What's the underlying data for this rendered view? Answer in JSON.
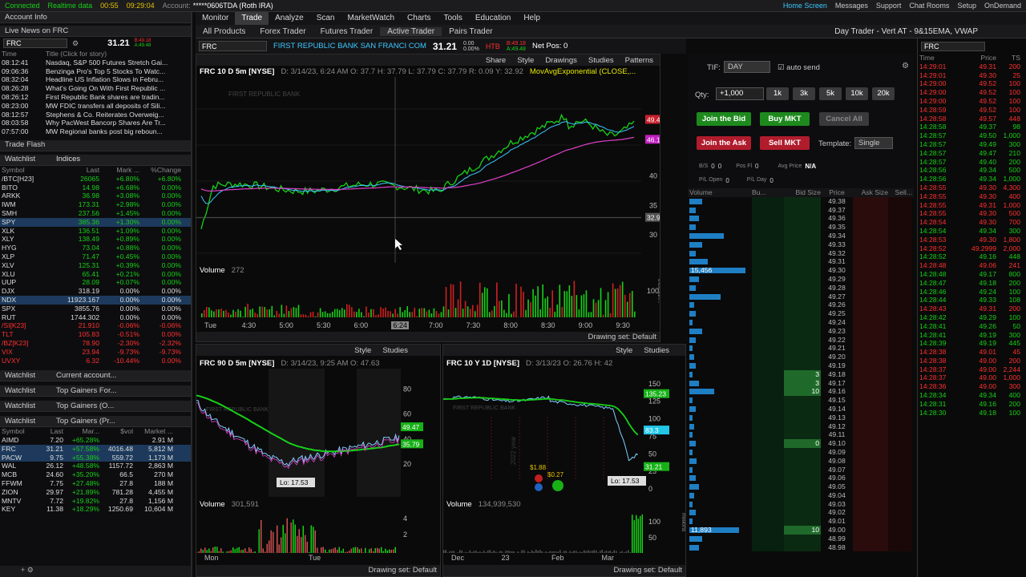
{
  "topbar": {
    "connected": "Connected",
    "realtime": "Realtime data",
    "timer": "00:55",
    "clock": "09:29:04",
    "account_label": "Account:",
    "account": "*****0606TDA (Roth IRA)",
    "home": "Home Screen",
    "messages": "Messages",
    "support": "Support",
    "chat": "Chat Rooms",
    "setup": "Setup",
    "ondemand": "OnDemand"
  },
  "nav": {
    "tabs": [
      "Monitor",
      "Trade",
      "Analyze",
      "Scan",
      "MarketWatch",
      "Charts",
      "Tools",
      "Education",
      "Help"
    ],
    "active": "Trade"
  },
  "subnav": {
    "tabs": [
      "All Products",
      "Forex Trader",
      "Futures Trader",
      "Active Trader",
      "Pairs Trader"
    ],
    "active": "Active Trader",
    "layout": "Day Trader - Vert AT - 9&15EMA, VWAP"
  },
  "left": {
    "account_info": "Account Info",
    "news_title": "Live News on FRC",
    "symbol": "FRC",
    "price": "31.21",
    "bid": "B:49.18",
    "ask": "A:49.48",
    "news_col_time": "Time",
    "news_col_title": "Title (Click for story)",
    "news": [
      [
        "08:12:41",
        "Nasdaq, S&P 500 Futures Stretch Gai..."
      ],
      [
        "09:06:36",
        "Benzinga Pro's Top 5 Stocks To Watc..."
      ],
      [
        "08:32:04",
        "Headline US Inflation Slows in Febru..."
      ],
      [
        "08:26:28",
        "What's Going On With First Republic ..."
      ],
      [
        "08:26:12",
        "First Republic Bank shares are tradin..."
      ],
      [
        "08:23:00",
        "MW FDIC transfers all deposits of Sili..."
      ],
      [
        "08:12:57",
        "Stephens & Co. Reiterates Overweig..."
      ],
      [
        "08:03:58",
        "Why PacWest Bancorp Shares Are Tr..."
      ],
      [
        "07:57:00",
        "MW Regional banks post big reboun..."
      ]
    ],
    "trade_flash": "Trade Flash",
    "watchlist": "Watchlist",
    "watchlist1": "Indices",
    "wl_cols": [
      "Symbol",
      "Last",
      "Mark ...",
      "%Change"
    ],
    "wl1": [
      [
        "/BTC[H23]",
        "26065",
        "+6.80%",
        "+6.80%",
        "g"
      ],
      [
        "BITO",
        "14.98",
        "+6.68%",
        "0.00%",
        "g"
      ],
      [
        "ARKK",
        "36.98",
        "+3.08%",
        "0.00%",
        "g"
      ],
      [
        "IWM",
        "173.31",
        "+2.98%",
        "0.00%",
        "g"
      ],
      [
        "SMH",
        "237.56",
        "+1.45%",
        "0.00%",
        "g"
      ],
      [
        "SPY",
        "385.36",
        "+1.30%",
        "0.00%",
        "g"
      ],
      [
        "XLK",
        "136.51",
        "+1.09%",
        "0.00%",
        "g"
      ],
      [
        "XLY",
        "138.49",
        "+0.89%",
        "0.00%",
        "g"
      ],
      [
        "HYG",
        "73.04",
        "+0.88%",
        "0.00%",
        "g"
      ],
      [
        "XLP",
        "71.47",
        "+0.45%",
        "0.00%",
        "g"
      ],
      [
        "XLV",
        "125.31",
        "+0.39%",
        "0.00%",
        "g"
      ],
      [
        "XLU",
        "65.41",
        "+0.21%",
        "0.00%",
        "g"
      ],
      [
        "UUP",
        "28.09",
        "+0.07%",
        "0.00%",
        "g"
      ],
      [
        "DJX",
        "318.19",
        "0.00%",
        "0.00%",
        "w"
      ],
      [
        "NDX",
        "11923.1672",
        "0.00%",
        "0.00%",
        "w"
      ],
      [
        "SPX",
        "3855.76",
        "0.00%",
        "0.00%",
        "w"
      ],
      [
        "RUT",
        "1744.302",
        "0.00%",
        "0.00%",
        "w"
      ],
      [
        "/SI[K23]",
        "21.910",
        "-0.06%",
        "-0.06%",
        "r"
      ],
      [
        "TLT",
        "105.83",
        "-0.51%",
        "0.00%",
        "r"
      ],
      [
        "/BZ[K23]",
        "78.90",
        "-2.30%",
        "-2.32%",
        "r"
      ],
      [
        "VIX",
        "23.94",
        "-9.73%",
        "-9.73%",
        "r"
      ],
      [
        "UVXY",
        "6.32",
        "-10.44%",
        "0.00%",
        "r"
      ]
    ],
    "wl2": "Current account...",
    "wl3": "Top Gainers For...",
    "wl4": "Top Gainers (O...",
    "wl5": "Top Gainers (Pr...",
    "wl5_cols": [
      "Symbol",
      "Last",
      "Mar...",
      "$vol",
      "Market ..."
    ],
    "gainers": [
      [
        "AIMD",
        "7.20",
        "+65.28%",
        "",
        "2.91 M"
      ],
      [
        "FRC",
        "31.21",
        "+57.58%",
        "4016.48",
        "5,812 M"
      ],
      [
        "PACW",
        "9.75",
        "+55.38%",
        "559.72",
        "1,173 M"
      ],
      [
        "WAL",
        "26.12",
        "+48.58%",
        "1157.72",
        "2,863 M"
      ],
      [
        "MCB",
        "24.60",
        "+35.20%",
        "66.5",
        "270 M"
      ],
      [
        "FFWM",
        "7.75",
        "+27.48%",
        "27.8",
        "188 M"
      ],
      [
        "ZION",
        "29.97",
        "+21.89%",
        "781.28",
        "4,455 M"
      ],
      [
        "MNTV",
        "7.72",
        "+19.82%",
        "27.8",
        "1,156 M"
      ],
      [
        "KEY",
        "11.38",
        "+18.29%",
        "1250.69",
        "10,604 M"
      ]
    ]
  },
  "ticker": {
    "symbol": "FRC",
    "name": "FIRST REPUBLIC BANK SAN FRANCI COM",
    "price": "31.21",
    "chg": "0.00",
    "pct": "0.00%",
    "htb": "HTB",
    "bid": "B:49.18",
    "ask": "A:49.48",
    "netpos": "Net Pos: 0"
  },
  "chart_main": {
    "title": "FRC 10 D 5m [NYSE]",
    "readout": "D: 3/14/23, 6:24 AM  O: 37.7  H: 37.79  L: 37.79  C: 37.79  R: 0.09  Y: 32.92",
    "study": "MovAvgExponential (CLOSE,...",
    "share": "Share",
    "style": "Style",
    "drawings": "Drawings",
    "studies": "Studies",
    "patterns": "Patterns",
    "vol_label": "Volume",
    "vol_val": "272",
    "xlabels": [
      "Tue",
      "4:30",
      "5:00",
      "5:30",
      "6:00",
      "6:24",
      "7:00",
      "7:30",
      "8:00",
      "8:30",
      "9:00",
      "9:30"
    ],
    "ylabels": [
      "40",
      "35",
      "30"
    ],
    "price_tag1": "49.47",
    "price_tag2": "46.1",
    "price_tag3": "32.92",
    "vol_axis": "100",
    "vol_unit": "thousan...",
    "drawing_set": "Drawing set: Default",
    "wm": "FIRST REPUBLIC BANK"
  },
  "chart_bl": {
    "title": "FRC 90 D 5m [NYSE]",
    "readout": "D: 3/14/23, 9:25 AM  O: 47.63",
    "style": "Style",
    "studies": "Studies",
    "ylabels": [
      "80",
      "60",
      "40",
      "20"
    ],
    "tag1": "49.47",
    "tag2": "35.79",
    "lo": "Lo: 17.53",
    "vol_label": "Volume",
    "vol_val": "301,591",
    "vol_ax": [
      "4",
      "2"
    ],
    "xlabels": [
      "Mon",
      "Tue"
    ],
    "drawing_set": "Drawing set: Default",
    "wm": "FIRST REPUBLIC BANK"
  },
  "chart_br": {
    "title": "FRC 10 Y 1D [NYSE]",
    "readout": "D: 3/13/23  O: 26.76  H: 42",
    "style": "Style",
    "studies": "Studies",
    "ylabels": [
      "150",
      "125",
      "100",
      "75",
      "50",
      "25",
      "0"
    ],
    "tag1": "135.23",
    "tag2": "83.3",
    "tag3": "31.21",
    "lo": "Lo: 17.53",
    "div1": "$1.88",
    "div2": "$0.27",
    "vol_label": "Volume",
    "vol_val": "134,939,530",
    "vol_ax": [
      "100",
      "50"
    ],
    "xlabels": [
      "Dec",
      "23",
      "Feb",
      "Mar"
    ],
    "drawing_set": "Drawing set: Default",
    "wm": "FIRST REPUBLIC BANK",
    "vol_unit": "millions",
    "year": "2022 year"
  },
  "order": {
    "tif_label": "TIF:",
    "tif": "DAY",
    "autosend": "auto send",
    "qty_label": "Qty:",
    "qty": "+1,000",
    "qtybtns": [
      "1k",
      "3k",
      "5k",
      "10k",
      "20k"
    ],
    "join_bid": "Join the Bid",
    "buy_mkt": "Buy MKT",
    "cancel": "Cancel All",
    "join_ask": "Join the Ask",
    "sell_mkt": "Sell MKT",
    "template_label": "Template:",
    "template": "Single",
    "bs": "B/S",
    "bs_v": "0",
    "bs_v2": "0",
    "pos_fl": "Pos Fl",
    "pos_v": "0",
    "avg": "Avg Price",
    "avg_v": "N/A",
    "pl_open": "P/L Open",
    "pl_v": "0",
    "pl_day": "P/L Day",
    "pl_d": "0"
  },
  "ladder": {
    "cols": [
      "Volume",
      "Bu...",
      "Bid Size",
      "Price",
      "Ask Size",
      "Sell..."
    ],
    "vol_tag1": "15,456",
    "vol_tag2": "11,893",
    "prices": [
      "49.38",
      "49.37",
      "49.36",
      "49.35",
      "49.34",
      "49.33",
      "49.32",
      "49.31",
      "49.30",
      "49.29",
      "49.28",
      "49.27",
      "49.26",
      "49.25",
      "49.24",
      "49.23",
      "49.22",
      "49.21",
      "49.20",
      "49.19",
      "49.18",
      "49.17",
      "49.16",
      "49.15",
      "49.14",
      "49.13",
      "49.12",
      "49.11",
      "49.10",
      "49.09",
      "49.08",
      "49.07",
      "49.06",
      "49.05",
      "49.04",
      "49.03",
      "49.02",
      "49.01",
      "49.00",
      "48.99",
      "48.98"
    ],
    "bids": {
      "20": "3",
      "21": "3",
      "22": "10",
      "28": "0",
      "38": "10"
    },
    "vols": [
      0.2,
      0.1,
      0.15,
      0.1,
      0.55,
      0.2,
      0.1,
      0.3,
      0.9,
      0.15,
      0.1,
      0.5,
      0.08,
      0.1,
      0.05,
      0.2,
      0.1,
      0.05,
      0.08,
      0.1,
      0.05,
      0.15,
      0.4,
      0.05,
      0.1,
      0.05,
      0.08,
      0.05,
      0.1,
      0.05,
      0.12,
      0.05,
      0.1,
      0.15,
      0.08,
      0.05,
      0.1,
      0.05,
      0.8,
      0.2,
      0.15
    ]
  },
  "ts": {
    "symbol": "FRC",
    "cols": [
      "Time",
      "Price",
      "TS"
    ],
    "rows": [
      [
        "14:29:01",
        "49.31",
        "200",
        "r"
      ],
      [
        "14:29:01",
        "49.30",
        "25",
        "r"
      ],
      [
        "14:29:00",
        "49.52",
        "100",
        "r"
      ],
      [
        "14:29:00",
        "49.52",
        "100",
        "r"
      ],
      [
        "14:29:00",
        "49.52",
        "100",
        "r"
      ],
      [
        "14:28:59",
        "49.52",
        "100",
        "r"
      ],
      [
        "14:28:58",
        "49.57",
        "448",
        "r"
      ],
      [
        "14:28:58",
        "49.37",
        "98",
        "g"
      ],
      [
        "14:28:57",
        "49.50",
        "1,000",
        "g"
      ],
      [
        "14:28:57",
        "49.49",
        "300",
        "g"
      ],
      [
        "14:28:57",
        "49.47",
        "210",
        "g"
      ],
      [
        "14:28:57",
        "49.40",
        "200",
        "g"
      ],
      [
        "14:28:56",
        "49.34",
        "500",
        "g"
      ],
      [
        "14:28:56",
        "49.34",
        "1,000",
        "g"
      ],
      [
        "14:28:55",
        "49.30",
        "4,300",
        "r"
      ],
      [
        "14:28:55",
        "49.30",
        "400",
        "r"
      ],
      [
        "14:28:55",
        "49.31",
        "1,000",
        "r"
      ],
      [
        "14:28:55",
        "49.30",
        "500",
        "r"
      ],
      [
        "14:28:54",
        "49.30",
        "700",
        "r"
      ],
      [
        "14:28:54",
        "49.34",
        "300",
        "g"
      ],
      [
        "14:28:53",
        "49.30",
        "1,800",
        "r"
      ],
      [
        "14:28:52",
        "49.2999",
        "2,000",
        "r"
      ],
      [
        "14:28:52",
        "49.16",
        "448",
        "g"
      ],
      [
        "14:28:48",
        "49.06",
        "241",
        "r"
      ],
      [
        "14:28:48",
        "49.17",
        "800",
        "g"
      ],
      [
        "14:28:47",
        "49.18",
        "200",
        "g"
      ],
      [
        "14:28:46",
        "49.24",
        "100",
        "g"
      ],
      [
        "14:28:44",
        "49.33",
        "108",
        "g"
      ],
      [
        "14:28:43",
        "49.31",
        "200",
        "r"
      ],
      [
        "14:28:42",
        "49.29",
        "100",
        "g"
      ],
      [
        "14:28:41",
        "49.26",
        "50",
        "g"
      ],
      [
        "14:28:41",
        "49.19",
        "300",
        "g"
      ],
      [
        "14:28:39",
        "49.19",
        "445",
        "g"
      ],
      [
        "14:28:38",
        "49.01",
        "45",
        "r"
      ],
      [
        "14:28:38",
        "49.00",
        "200",
        "r"
      ],
      [
        "14:28:37",
        "49.00",
        "2,244",
        "r"
      ],
      [
        "14:28:37",
        "49.00",
        "1,000",
        "r"
      ],
      [
        "14:28:36",
        "49.00",
        "300",
        "r"
      ],
      [
        "14:28:34",
        "49.34",
        "400",
        "g"
      ],
      [
        "14:28:31",
        "49.16",
        "200",
        "g"
      ],
      [
        "14:28:30",
        "49.18",
        "100",
        "g"
      ]
    ]
  }
}
